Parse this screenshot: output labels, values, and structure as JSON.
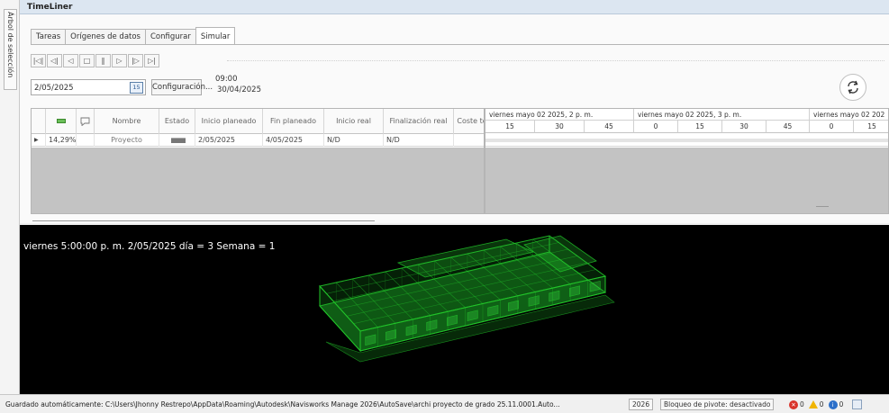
{
  "side_tab": {
    "label": "Árbol de selección"
  },
  "panel": {
    "title": "TimeLiner"
  },
  "tabs": [
    {
      "label": "Tareas"
    },
    {
      "label": "Orígenes de datos"
    },
    {
      "label": "Configurar"
    },
    {
      "label": "Simular",
      "active": true
    }
  ],
  "playback": {
    "buttons": [
      {
        "name": "rewind-to-start",
        "glyph": "|◁|"
      },
      {
        "name": "step-back",
        "glyph": "◁|"
      },
      {
        "name": "play-reverse",
        "glyph": "◁"
      },
      {
        "name": "stop",
        "glyph": "□"
      },
      {
        "name": "pause",
        "glyph": "‖"
      },
      {
        "name": "play",
        "glyph": "▷"
      },
      {
        "name": "step-forward",
        "glyph": "|▷"
      },
      {
        "name": "forward-to-end",
        "glyph": "▷|"
      }
    ]
  },
  "date_picker": {
    "value": "2/05/2025",
    "calendar_icon": "15"
  },
  "config_button": "Configuración...",
  "sim_time": {
    "time": "09:00",
    "date": "30/04/2025"
  },
  "grid": {
    "columns": [
      "",
      "",
      "",
      "Nombre",
      "Estado",
      "Inicio planeado",
      "Fin planeado",
      "Inicio real",
      "Finalización real",
      "Coste to"
    ],
    "row": {
      "pointer": "▶",
      "percent": "14,29%",
      "name": "Proyecto",
      "start_planned": "2/05/2025",
      "end_planned": "4/05/2025",
      "start_real": "N/D",
      "end_real": "N/D"
    }
  },
  "gantt": {
    "bands": [
      "viernes mayo 02 2025, 2 p. m.",
      "viernes mayo 02 2025, 3 p. m.",
      "viernes mayo 02 202"
    ],
    "ticks": [
      "15",
      "30",
      "45",
      "0",
      "15",
      "30",
      "45",
      "0",
      "15"
    ]
  },
  "viewport": {
    "overlay": "viernes 5:00:00 p. m. 2/05/2025 día = 3 Semana = 1",
    "model_color": "#22c52a"
  },
  "status_bar": {
    "autosave": "Guardado automáticamente: C:\\Users\\Jhonny Restrepo\\AppData\\Roaming\\Autodesk\\Navisworks Manage 2026\\AutoSave\\archi proyecto de grado 25.11.0001.Auto...",
    "year": "2026",
    "pivot": "Bloqueo de pivote: desactivado",
    "errors": "0",
    "warnings": "0",
    "info": "0"
  }
}
